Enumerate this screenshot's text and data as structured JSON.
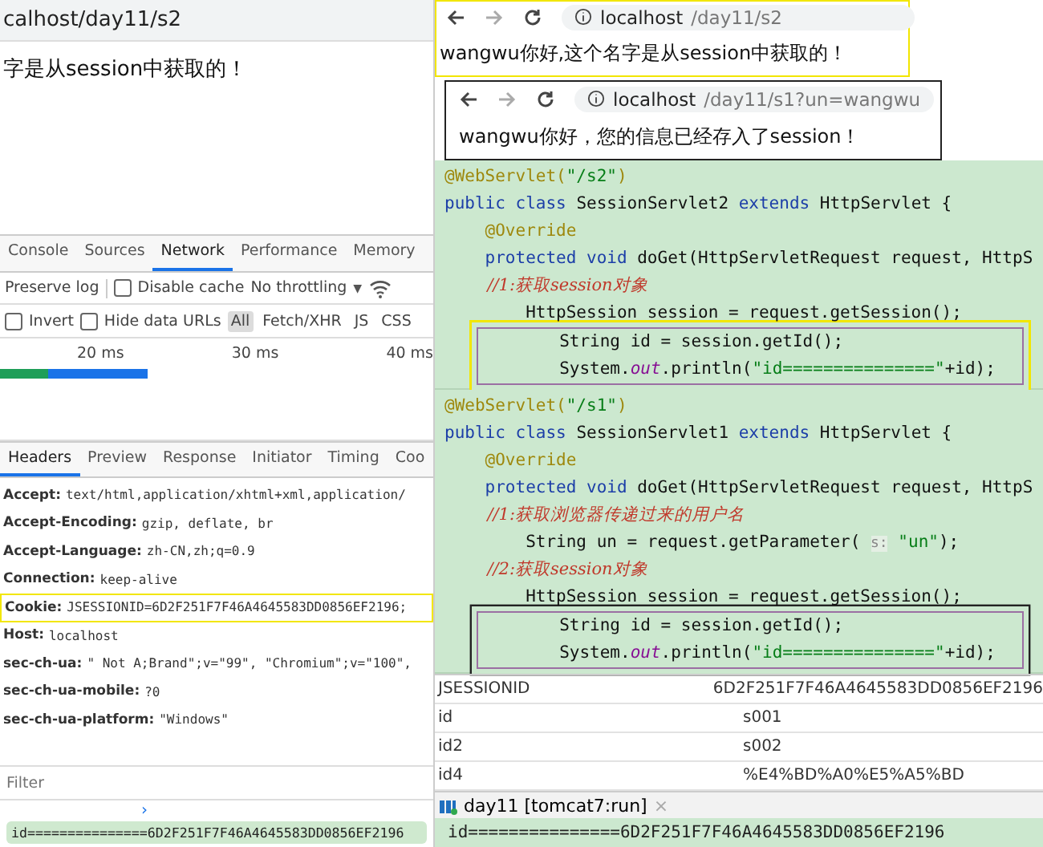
{
  "left_browser": {
    "url": "calhost/day11/s2",
    "page_text": "字是从session中获取的！"
  },
  "devtools": {
    "tabs": [
      {
        "label": "Console",
        "selected": false
      },
      {
        "label": "Sources",
        "selected": false
      },
      {
        "label": "Network",
        "selected": true
      },
      {
        "label": "Performance",
        "selected": false
      },
      {
        "label": "Memory",
        "selected": false
      }
    ],
    "toolbar": {
      "preserve_log": "Preserve log",
      "disable_cache": {
        "label": "Disable cache",
        "checked": false
      },
      "throttling": "No throttling",
      "caret": "▼"
    },
    "filters": {
      "invert": {
        "label": "Invert",
        "checked": false
      },
      "hide_data_urls": {
        "label": "Hide data URLs",
        "checked": false
      },
      "types": [
        {
          "label": "All",
          "selected": true
        },
        {
          "label": "Fetch/XHR",
          "selected": false
        },
        {
          "label": "JS",
          "selected": false
        },
        {
          "label": "CSS",
          "selected": false
        }
      ]
    },
    "timeline_ticks": [
      "20 ms",
      "30 ms",
      "40 ms"
    ],
    "detail_tabs": [
      {
        "label": "Headers",
        "selected": true
      },
      {
        "label": "Preview",
        "selected": false
      },
      {
        "label": "Response",
        "selected": false
      },
      {
        "label": "Initiator",
        "selected": false
      },
      {
        "label": "Timing",
        "selected": false
      },
      {
        "label": "Coo",
        "selected": false
      }
    ],
    "headers": [
      {
        "name": "Accept:",
        "value": "text/html,application/xhtml+xml,application/"
      },
      {
        "name": "Accept-Encoding:",
        "value": "gzip, deflate, br"
      },
      {
        "name": "Accept-Language:",
        "value": "zh-CN,zh;q=0.9"
      },
      {
        "name": "Connection:",
        "value": "keep-alive"
      },
      {
        "name": "Cookie:",
        "value": "JSESSIONID=6D2F251F7F46A4645583DD0856EF2196;"
      },
      {
        "name": "Host:",
        "value": "localhost"
      },
      {
        "name": "sec-ch-ua:",
        "value": "\" Not A;Brand\";v=\"99\", \"Chromium\";v=\"100\","
      },
      {
        "name": "sec-ch-ua-mobile:",
        "value": "?0"
      },
      {
        "name": "sec-ch-ua-platform:",
        "value": "\"Windows\""
      }
    ],
    "filter_placeholder": "Filter",
    "console_prompt": "›",
    "console_output": "id===============6D2F251F7F46A4645583DD0856EF2196"
  },
  "browsers": [
    {
      "url_host": "localhost",
      "url_path": "/day11/s2",
      "page_text": "wangwu你好,这个名字是从session中获取的！"
    },
    {
      "url_host": "localhost",
      "url_path": "/day11/s1?un=wangwu",
      "page_text": "wangwu你好，您的信息已经存入了session！"
    }
  ],
  "code_panels": [
    {
      "lines": [
        [
          {
            "kind": "annot",
            "text": "@WebServlet("
          },
          {
            "kind": "str",
            "text": "\"/s2\""
          },
          {
            "kind": "annot",
            "text": ")"
          }
        ],
        [
          {
            "kind": "kw",
            "text": "public class "
          },
          {
            "kind": "plain",
            "text": "SessionServlet2 "
          },
          {
            "kind": "kw",
            "text": "extends "
          },
          {
            "kind": "plain",
            "text": "HttpServlet {"
          }
        ],
        [
          {
            "kind": "annot",
            "text": "    @Override"
          }
        ],
        [
          {
            "kind": "kw",
            "text": "    protected void "
          },
          {
            "kind": "plain",
            "text": "doGet(HttpServletRequest request, HttpS"
          }
        ],
        [
          {
            "kind": "comment",
            "text": "        //1:获取session对象"
          }
        ],
        [
          {
            "kind": "plain",
            "text": "        HttpSession session = request.getSession();"
          }
        ]
      ],
      "boxed_lines": [
        [
          {
            "kind": "plain",
            "text": "        String id = session.getId();"
          }
        ],
        [
          {
            "kind": "plain",
            "text": "        System."
          },
          {
            "kind": "field",
            "text": "out"
          },
          {
            "kind": "plain",
            "text": ".println("
          },
          {
            "kind": "str",
            "text": "\"id===============\""
          },
          {
            "kind": "plain",
            "text": "+id);"
          }
        ]
      ]
    },
    {
      "lines": [
        [
          {
            "kind": "annot",
            "text": "@WebServlet("
          },
          {
            "kind": "str",
            "text": "\"/s1\""
          },
          {
            "kind": "annot",
            "text": ")"
          }
        ],
        [
          {
            "kind": "kw",
            "text": "public class "
          },
          {
            "kind": "plain",
            "text": "SessionServlet1 "
          },
          {
            "kind": "kw",
            "text": "extends "
          },
          {
            "kind": "plain",
            "text": "HttpServlet {"
          }
        ],
        [
          {
            "kind": "annot",
            "text": "    @Override"
          }
        ],
        [
          {
            "kind": "kw",
            "text": "    protected void "
          },
          {
            "kind": "plain",
            "text": "doGet(HttpServletRequest request, HttpS"
          }
        ],
        [
          {
            "kind": "comment",
            "text": "        //1:获取浏览器传递过来的用户名"
          }
        ],
        [
          {
            "kind": "plain",
            "text": "        String un = request.getParameter( "
          },
          {
            "kind": "hint",
            "text": "s:"
          },
          {
            "kind": "str",
            "text": " \"un\""
          },
          {
            "kind": "plain",
            "text": ");"
          }
        ],
        [
          {
            "kind": "comment",
            "text": "        //2:获取session对象"
          }
        ],
        [
          {
            "kind": "plain",
            "text": "        HttpSession session = request.getSession();"
          }
        ]
      ],
      "boxed_lines": [
        [
          {
            "kind": "plain",
            "text": "        String id = session.getId();"
          }
        ],
        [
          {
            "kind": "plain",
            "text": "        System."
          },
          {
            "kind": "field",
            "text": "out"
          },
          {
            "kind": "plain",
            "text": ".println("
          },
          {
            "kind": "str",
            "text": "\"id===============\""
          },
          {
            "kind": "plain",
            "text": "+id);"
          }
        ]
      ]
    }
  ],
  "cookie_table": [
    {
      "name": "JSESSIONID",
      "value": "6D2F251F7F46A4645583DD0856EF2196"
    },
    {
      "name": "id",
      "value": "s001"
    },
    {
      "name": "id2",
      "value": "s002"
    },
    {
      "name": "id4",
      "value": "%E4%BD%A0%E5%A5%BD"
    }
  ],
  "run_tab": {
    "label": "day11 [tomcat7:run]",
    "close": "×"
  },
  "run_output": "id===============6D2F251F7F46A4645583DD0856EF2196"
}
